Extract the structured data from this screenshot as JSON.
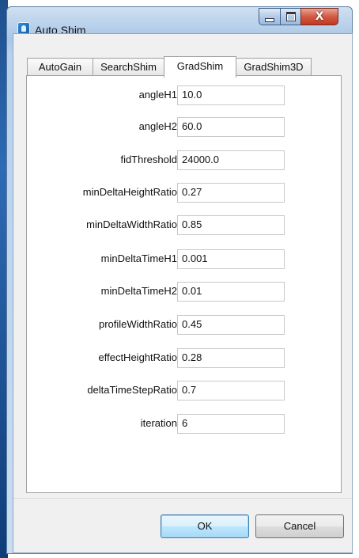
{
  "window": {
    "title": "Auto Shim",
    "icon": "app-icon",
    "controls": {
      "minimize": "minimize-icon",
      "maximize": "maximize-icon",
      "close_label": "X"
    }
  },
  "tabs": [
    {
      "label": "AutoGain",
      "active": false
    },
    {
      "label": "SearchShim",
      "active": false
    },
    {
      "label": "GradShim",
      "active": true
    },
    {
      "label": "GradShim3D",
      "active": false
    }
  ],
  "fields": [
    {
      "label": "angleH1",
      "value": "10.0"
    },
    {
      "label": "angleH2",
      "value": "60.0"
    },
    {
      "label": "fidThreshold",
      "value": "24000.0"
    },
    {
      "label": "minDeltaHeightRatio",
      "value": "0.27"
    },
    {
      "label": "minDeltaWidthRatio",
      "value": "0.85"
    },
    {
      "label": "minDeltaTimeH1",
      "value": "0.001"
    },
    {
      "label": "minDeltaTimeH2",
      "value": "0.01"
    },
    {
      "label": "profileWidthRatio",
      "value": "0.45"
    },
    {
      "label": "effectHeightRatio",
      "value": "0.28"
    },
    {
      "label": "deltaTimeStepRatio",
      "value": "0.7"
    },
    {
      "label": "iteration",
      "value": "6"
    }
  ],
  "buttons": {
    "ok": "OK",
    "cancel": "Cancel"
  },
  "colors": {
    "titlebar": "#a9c6e6",
    "close": "#c0391f",
    "default_button": "#3c7fb1"
  }
}
